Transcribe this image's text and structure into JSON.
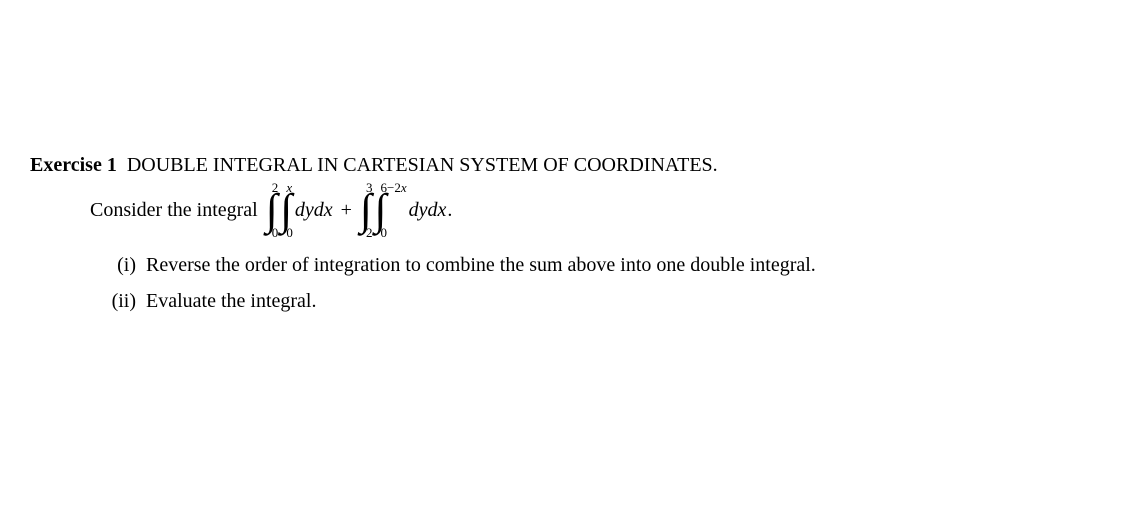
{
  "exercise": {
    "label": "Exercise 1",
    "title": "DOUBLE INTEGRAL IN CARTESIAN SYSTEM OF COORDINATES."
  },
  "consider": {
    "prefix": "Consider the integral",
    "integral1": {
      "outer_lower": "0",
      "outer_upper": "2",
      "inner_lower": "0",
      "inner_upper": "x",
      "integrand": "dydx"
    },
    "plus": "+",
    "integral2": {
      "outer_lower": "2",
      "outer_upper": "3",
      "inner_lower": "0",
      "inner_upper": "6−2x",
      "integrand": "dydx"
    },
    "terminator": "."
  },
  "items": [
    {
      "marker": "(i)",
      "text": "Reverse the order of integration to combine the sum above into one double integral."
    },
    {
      "marker": "(ii)",
      "text": "Evaluate the integral."
    }
  ]
}
